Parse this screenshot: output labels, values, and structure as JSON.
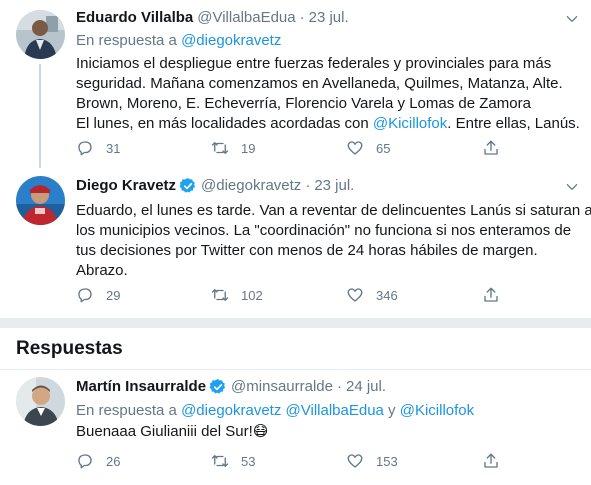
{
  "tweets": [
    {
      "name": "Eduardo Villalba",
      "handle": "@VillalbaEdua",
      "separator": "·",
      "date": "23 jul.",
      "reply_prefix": "En respuesta a ",
      "reply_mentions": [
        "@diegokravetz"
      ],
      "lines": [
        "Iniciamos el despliegue entre fuerzas federales y provinciales para más",
        "seguridad. Mañana comenzamos en Avellaneda, Quilmes, Matanza, Alte.",
        "Brown, Moreno, E. Echeverría, Florencio Varela y Lomas de Zamora",
        "El lunes, en más localidades acordadas con ",
        "@Kicillofok",
        ". Entre ellas, Lanús."
      ],
      "replies": "31",
      "retweets": "19",
      "likes": "65"
    },
    {
      "name": "Diego Kravetz",
      "handle": "@diegokravetz",
      "separator": "·",
      "date": "23 jul.",
      "lines": [
        "Eduardo, el lunes es tarde. Van a reventar de delincuentes Lanús si saturan a",
        "los municipios vecinos. La \"coordinación\" no funciona si nos enteramos de",
        "tus decisiones por Twitter con menos de 24 horas hábiles de margen.",
        "Abrazo."
      ],
      "replies": "29",
      "retweets": "102",
      "likes": "346"
    }
  ],
  "section_title": "Respuestas",
  "reply_tweet": {
    "name": "Martín Insaurralde",
    "handle": "@minsaurralde",
    "separator": "·",
    "date": "24 jul.",
    "reply_prefix": "En respuesta a ",
    "mention_1": "@diegokravetz",
    "mention_2": "@VillalbaEdua",
    "conjunction": " y ",
    "mention_3": "@Kicillofok",
    "text": "Buenaaa Giulianiii del Sur!",
    "emoji": "😷",
    "replies": "26",
    "retweets": "53",
    "likes": "153"
  },
  "colors": {
    "accent": "#1da1f2",
    "link": "#1b95e0",
    "secondary_text": "#657786",
    "separator": "#e6ecf0"
  },
  "icons": [
    "reply-icon",
    "retweet-icon",
    "like-icon",
    "share-icon",
    "chevron-down-icon",
    "verified-badge-icon"
  ]
}
